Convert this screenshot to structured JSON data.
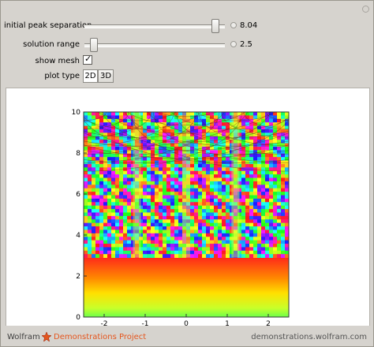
{
  "controls": {
    "peak_separation": {
      "label": "initial peak separation",
      "value": "8.04",
      "fraction": 0.96
    },
    "solution_range": {
      "label": "solution range",
      "value": "2.5",
      "fraction": 0.04
    },
    "show_mesh": {
      "label": "show mesh",
      "checked": true,
      "mark": "✓"
    },
    "plot_type": {
      "label": "plot type",
      "options": [
        "2D",
        "3D"
      ],
      "selected": "2D"
    }
  },
  "footer": {
    "brand": "Wolfram",
    "project": "Demonstrations Project",
    "site": "demonstrations.wolfram.com",
    "brand_color": "#3f3f3f",
    "project_color": "#e5561e"
  },
  "chart_data": {
    "type": "heatmap",
    "x_ticks": [
      "-2",
      "-1",
      "0",
      "1",
      "2"
    ],
    "y_ticks": [
      "0",
      "2",
      "4",
      "6",
      "8",
      "10"
    ],
    "xlim": [
      -2.5,
      2.5
    ],
    "ylim": [
      0,
      10
    ],
    "grid": false,
    "colormap": "hue"
  }
}
